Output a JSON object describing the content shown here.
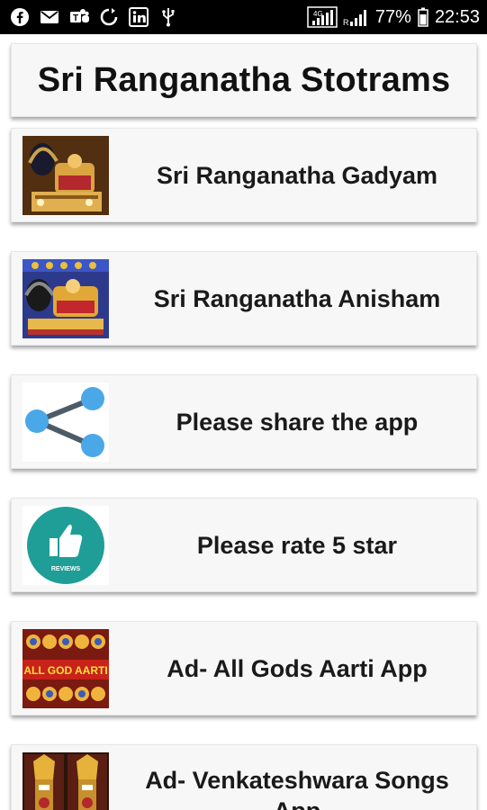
{
  "status_bar": {
    "battery": "77%",
    "time": "22:53",
    "network_badge": "4G",
    "icons_left": [
      "facebook-icon",
      "mail-icon",
      "teams-icon",
      "sync-icon",
      "linkedin-icon",
      "usb-icon"
    ]
  },
  "header": {
    "title": "Sri Ranganatha Stotrams"
  },
  "items": [
    {
      "label": "Sri Ranganatha Gadyam",
      "thumb": "deity-image-1"
    },
    {
      "label": "Sri Ranganatha Anisham",
      "thumb": "deity-image-2"
    },
    {
      "label": "Please share the app",
      "thumb": "share-icon"
    },
    {
      "label": "Please rate 5 star",
      "thumb": "reviews-thumbs-up-icon",
      "thumb_caption": "REVIEWS"
    },
    {
      "label": "Ad- All Gods Aarti App",
      "thumb": "all-god-aarti-image",
      "thumb_caption": "ALL GOD AARTI"
    },
    {
      "label": "Ad- Venkateshwara Songs App",
      "thumb": "venkateshwara-image"
    }
  ],
  "colors": {
    "card_bg": "#f7f7f7",
    "share_blue": "#4aa8e8",
    "share_line": "#4b5b68",
    "reviews_teal": "#1f9e98",
    "statusbar_bg": "#000000"
  }
}
